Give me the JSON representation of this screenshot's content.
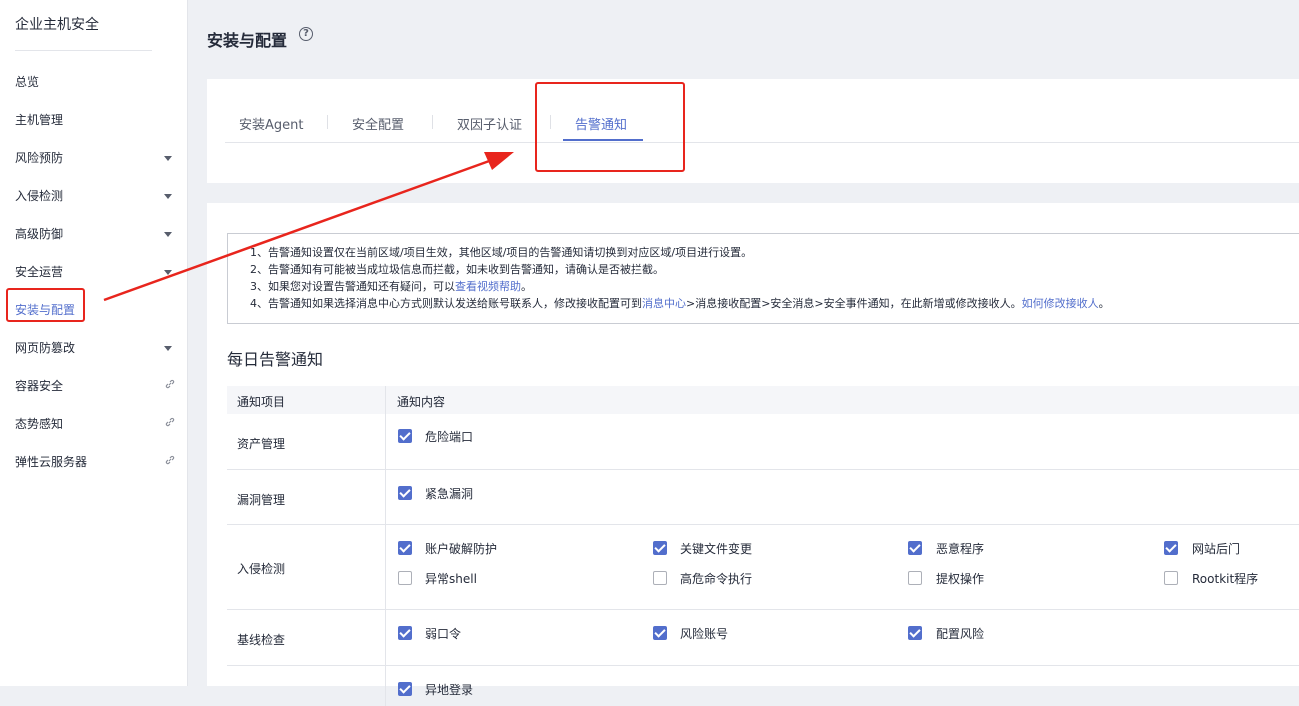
{
  "sidebar": {
    "title": "企业主机安全",
    "items": [
      {
        "label": "总览",
        "expand": false,
        "link": false
      },
      {
        "label": "主机管理",
        "expand": false,
        "link": false
      },
      {
        "label": "风险预防",
        "expand": true,
        "link": false
      },
      {
        "label": "入侵检测",
        "expand": true,
        "link": false
      },
      {
        "label": "高级防御",
        "expand": true,
        "link": false
      },
      {
        "label": "安全运营",
        "expand": true,
        "link": false
      },
      {
        "label": "安装与配置",
        "expand": false,
        "link": false,
        "active": true
      },
      {
        "label": "网页防篡改",
        "expand": true,
        "link": false
      },
      {
        "label": "容器安全",
        "expand": false,
        "link": true
      },
      {
        "label": "态势感知",
        "expand": false,
        "link": true
      },
      {
        "label": "弹性云服务器",
        "expand": false,
        "link": true
      }
    ]
  },
  "header": {
    "title": "安装与配置",
    "help_icon": "?"
  },
  "tabs": [
    {
      "label": "安装Agent"
    },
    {
      "label": "安全配置"
    },
    {
      "label": "双因子认证"
    },
    {
      "label": "告警通知",
      "active": true
    }
  ],
  "notice": {
    "line1": "1、告警通知设置仅在当前区域/项目生效，其他区域/项目的告警通知请切换到对应区域/项目进行设置。",
    "line2": "2、告警通知有可能被当成垃圾信息而拦截，如未收到告警通知，请确认是否被拦截。",
    "line3_pre": "3、如果您对设置告警通知还有疑问，可以",
    "line3_link": "查看视频帮助",
    "line3_post": "。",
    "line4_pre": "4、告警通知如果选择消息中心方式则默认发送给账号联系人，修改接收配置可到",
    "line4_link1": "消息中心",
    "line4_mid": ">消息接收配置>安全消息>安全事件通知，在此新增或修改接收人。",
    "line4_link2": "如何修改接收人",
    "line4_post": "。"
  },
  "daily": {
    "title": "每日告警通知",
    "col_item": "通知项目",
    "col_content": "通知内容",
    "rows": [
      {
        "label": "资产管理",
        "options": [
          {
            "text": "危险端口",
            "checked": true
          }
        ]
      },
      {
        "label": "漏洞管理",
        "options": [
          {
            "text": "紧急漏洞",
            "checked": true
          }
        ]
      },
      {
        "label": "入侵检测",
        "options": [
          {
            "text": "账户破解防护",
            "checked": true
          },
          {
            "text": "关键文件变更",
            "checked": true
          },
          {
            "text": "恶意程序",
            "checked": true
          },
          {
            "text": "网站后门",
            "checked": true
          },
          {
            "text": "异常shell",
            "checked": false
          },
          {
            "text": "高危命令执行",
            "checked": false
          },
          {
            "text": "提权操作",
            "checked": false
          },
          {
            "text": "Rootkit程序",
            "checked": false
          }
        ]
      },
      {
        "label": "基线检查",
        "options": [
          {
            "text": "弱口令",
            "checked": true
          },
          {
            "text": "风险账号",
            "checked": true
          },
          {
            "text": "配置风险",
            "checked": true
          }
        ]
      },
      {
        "label": "",
        "options": [
          {
            "text": "异地登录",
            "checked": true
          }
        ]
      }
    ]
  },
  "colors": {
    "accent": "#526ecc",
    "annotation": "#e8251d"
  }
}
